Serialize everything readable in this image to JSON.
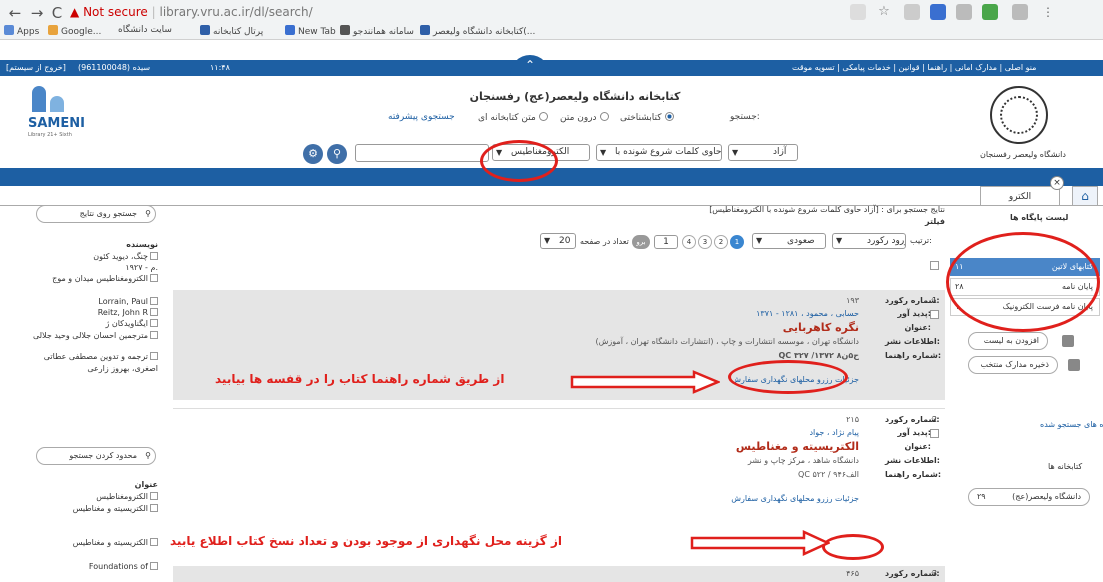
{
  "browser": {
    "security_label": "Not secure",
    "url": "library.vru.ac.ir/dl/search/",
    "bookmarks": [
      "Apps",
      "Google...",
      "سایت دانشگاه",
      "پرتال کتابخانه",
      "New Tab",
      "سامانه همانندجو",
      "کتابخانه دانشگاه ولیعصر(..."
    ]
  },
  "topbar": {
    "left_login": "[خروج از سیستم]",
    "left_user": "(961100048) سیده",
    "left_time": "۱۱:۴۸",
    "right_links": "منو اصلی | مدارک امانی | راهنما | قوانین | خدمات پیامکی | تسویه موقت"
  },
  "header": {
    "site_title": "کتابخانه دانشگاه ولیعصر(عج) رفسنجان",
    "search_label": "جستجو:",
    "radio_library": "کتابشناختی",
    "radio_fulltext": "درون متن",
    "radio_library_text": "متن کتابخانه ای",
    "advanced_link": "جستجوی پیشرفته",
    "field_select": "آزاد",
    "condition_select": "حاوی کلمات شروع شونده با",
    "search_term": "الکترومغناطیس",
    "logo_name": "SAMENI",
    "logo_sub": "Library 21+ Sixth",
    "uni_name": "دانشگاه ولیعصر رفسنجان"
  },
  "tabs": {
    "active": "الکترو",
    "close": "×"
  },
  "right_sidebar": {
    "title": "لیست پایگاه ها",
    "databases": [
      {
        "label": "کتابهای لاتین",
        "count": "۱۱"
      },
      {
        "label": "پایان نامه",
        "count": "۲۸"
      },
      {
        "label": "پایان نامه فرست الکترونیک",
        "count": "۱"
      }
    ],
    "add_to_list": "افزودن به لیست",
    "save_selected": "ذخیره مدارک منتخب",
    "searched_db_title": "پایگاه های جستجو شده",
    "library_label": "کتابخانه ها",
    "library_item": "دانشگاه ولیعصر(عج)",
    "library_count": "۲۹"
  },
  "results_header": {
    "summary": "نتایج جستجو برای : [آزاد حاوی کلمات شروع شونده با الکترومغناطیس]",
    "filter": "فیلتر",
    "sort_label": "ترتیب:",
    "sort_field": "ورود رکورد",
    "sort_dir": "صعودی",
    "pages": [
      "1",
      "2",
      "3",
      "4"
    ],
    "page_input": "1",
    "go": "برو",
    "per_page_label": "تعداد در صفحه",
    "per_page": "20"
  },
  "results": [
    {
      "index": "1",
      "fields": {
        "record_no": "شماره رکورد:",
        "author": "پدید آور:",
        "title": "عنوان:",
        "pub": "اطلاعات نشر:",
        "call": "شماره راهنما:"
      },
      "record_no": "۱۹۳",
      "author": "حسابی ، محمود ، ۱۲۸۱ - ۱۳۷۱",
      "title": "نگره کاهربایی",
      "pub": "دانشگاه تهران ، موسسه انتشارات و چاپ ، (انتشارات دانشگاه تهران ، آموزش)",
      "call": "QC ۳۲۷ /ح۵ن۸ ۱۳۷۲",
      "links": "جزئیات  رزرو  محلهای نگهداری  سفارش"
    },
    {
      "index": "2",
      "fields": {
        "record_no": "شماره رکورد:",
        "author": "پدید آور:",
        "title": "عنوان:",
        "pub": "اطلاعات نشر:",
        "call": "شماره راهنما:"
      },
      "record_no": "۲۱۵",
      "author": "پیام نژاد ، جواد",
      "title": "الکتریسیته و مغناطیس",
      "pub": "دانشگاه شاهد ، مرکز چاپ و نشر",
      "call": "QC ۵۲۲ / ۹الف۴۶",
      "links": "جزئیات  رزرو  محلهای نگهداری  سفارش"
    },
    {
      "index": "3",
      "fields": {
        "record_no": "شماره رکورد:"
      },
      "record_no": "۴۶۵"
    }
  ],
  "left_sidebar": {
    "search_in_results": "جستجو روی نتایج",
    "author_title": "نویسنده",
    "authors": [
      "چنگ، دیوید کئون",
      "۱۹۲۷ - م.",
      "الکترومغناطیس میدان و موج",
      "Lorrain, Paul",
      "Reitz, John R",
      "ایگناویدکان ژ",
      "مترجمین احسان جلالی وحید جلالی",
      "ترجمه و تدوین مصطفی عطاتی",
      "اصغری، بهروز زارعی"
    ],
    "limit_search": "محدود کردن جستجو",
    "subject_title": "عنوان",
    "subjects": [
      "الکترومغناطیس",
      "الکتریسیته و مغناطیس",
      "الکتریسیته و مغناطیس",
      "Foundations of"
    ]
  },
  "annotations": {
    "call_number_note": "از طریق شماره راهنما کتاب را در قفسه ها بیابید",
    "holdings_note": "از گزینه محل نگهداری از موجود بودن و تعداد نسخ کتاب اطلاع یابید"
  }
}
